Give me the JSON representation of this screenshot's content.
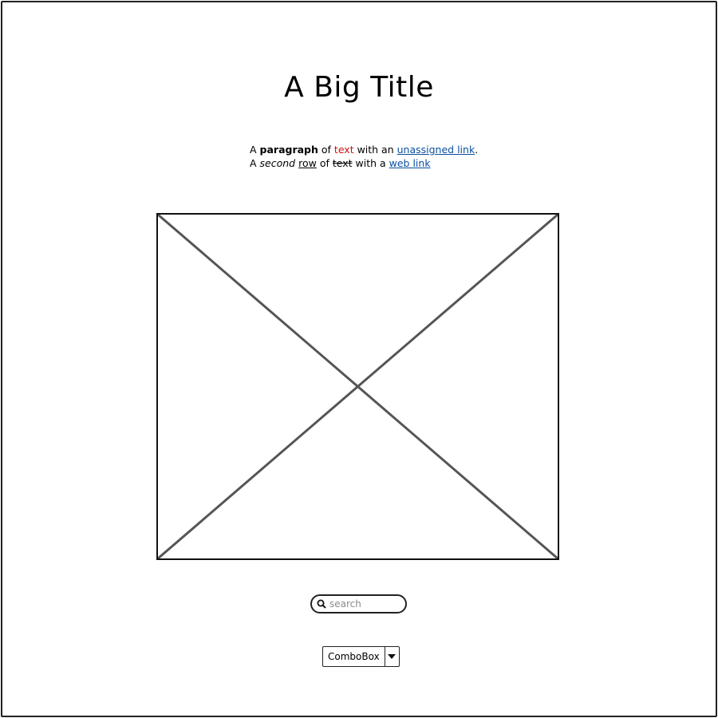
{
  "title": "A Big Title",
  "paragraph": {
    "line1": {
      "a": "A ",
      "bold": "paragraph",
      "of": " of ",
      "red": "text",
      "with": " with an ",
      "link": "unassigned link",
      "end": "."
    },
    "line2": {
      "a": "A ",
      "italic": "second",
      "space": " ",
      "underlined": "row",
      "of": " of ",
      "strike": "text",
      "with": " with a ",
      "link": "web link"
    }
  },
  "image_placeholder": {
    "icon": "image-placeholder-cross"
  },
  "search": {
    "placeholder": "search",
    "value": "",
    "icon": "search-icon"
  },
  "combobox": {
    "selected": "ComboBox",
    "icon": "caret-down-icon"
  },
  "colors": {
    "text_red": "#cc1111",
    "link": "#0b4f9e",
    "border": "#222222",
    "cross": "#555555"
  }
}
